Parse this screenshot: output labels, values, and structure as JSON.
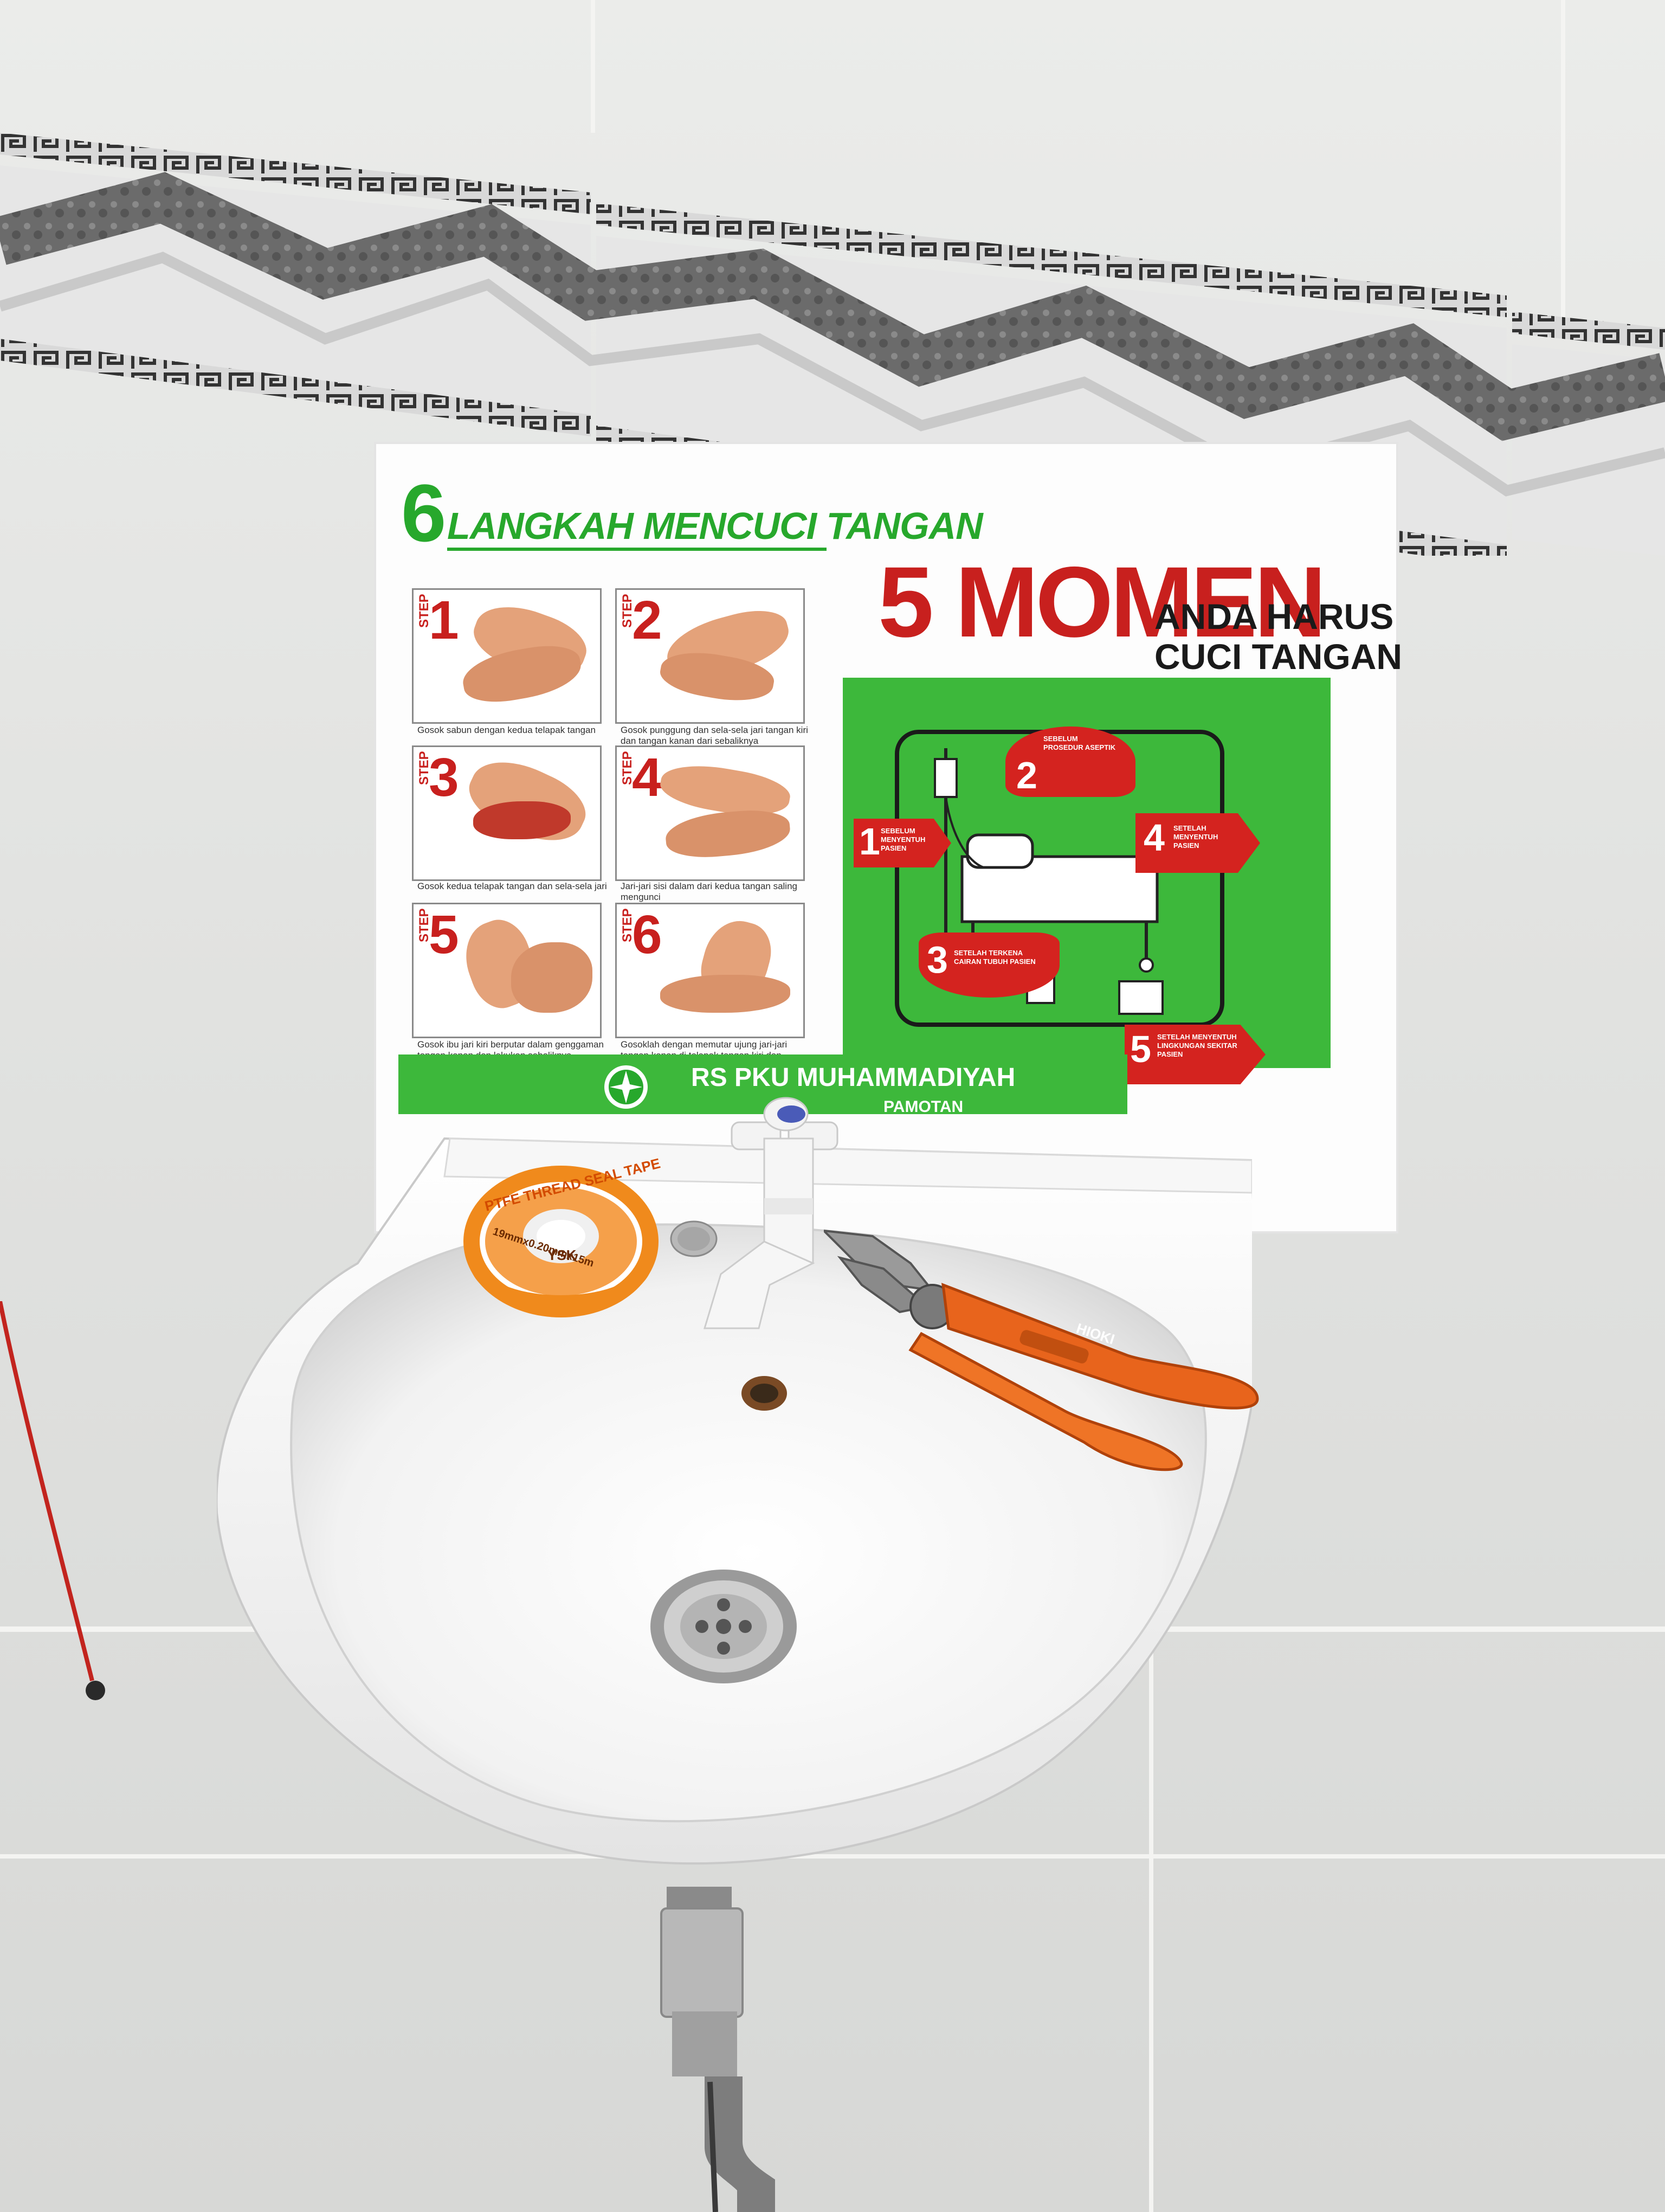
{
  "poster": {
    "left_title_number": "6",
    "left_title": "LANGKAH MENCUCI TANGAN",
    "right_title": "5 MOMEN",
    "right_subtitle_line1": "ANDA HARUS",
    "right_subtitle_line2": "CUCI TANGAN",
    "step_tag": "STEP",
    "steps": [
      {
        "number": "1",
        "caption": "Gosok sabun dengan kedua telapak tangan"
      },
      {
        "number": "2",
        "caption": "Gosok punggung dan sela-sela jari tangan kiri dan tangan kanan dari sebaliknya"
      },
      {
        "number": "3",
        "caption": "Gosok kedua telapak tangan dan sela-sela jari"
      },
      {
        "number": "4",
        "caption": "Jari-jari sisi dalam dari kedua tangan saling mengunci"
      },
      {
        "number": "5",
        "caption": "Gosok ibu jari kiri berputar dalam genggaman tangan kanan dan lakukan sebaliknya"
      },
      {
        "number": "6",
        "caption": "Gosoklah dengan memutar ujung jari-jari tangan kanan di telapak tangan kiri dan sebaliknya"
      }
    ],
    "moments": [
      {
        "number": "1",
        "label": "SEBELUM MENYENTUH PASIEN"
      },
      {
        "number": "2",
        "label": "SEBELUM PROSEDUR ASEPTIK"
      },
      {
        "number": "3",
        "label": "SETELAH TERKENA CAIRAN TUBUH PASIEN"
      },
      {
        "number": "4",
        "label": "SETELAH MENYENTUH PASIEN"
      },
      {
        "number": "5",
        "label": "SETELAH MENYENTUH LINGKUNGAN SEKITAR PASIEN"
      }
    ],
    "footer_name": "RS PKU MUHAMMADIYAH",
    "footer_sub": "PAMOTAN"
  },
  "tape": {
    "line1": "PTFE THREAD SEAL TAPE",
    "brand": "YSK",
    "size": "19mmx0.20mmx15m"
  },
  "pliers": {
    "brand": "HIOKI"
  },
  "colors": {
    "poster_green": "#3db83b",
    "poster_red": "#c8201e",
    "pliers_orange": "#e8641c",
    "tape_orange": "#f08a1c"
  }
}
